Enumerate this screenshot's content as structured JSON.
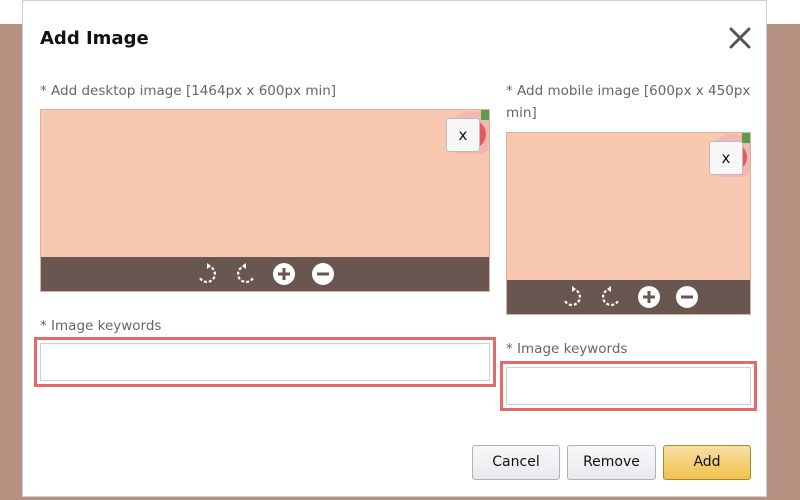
{
  "dialog": {
    "title": "Add Image"
  },
  "desktop": {
    "label": "* Add desktop image [1464px x 600px min]",
    "remove_label": "x",
    "keywords_label": "* Image keywords",
    "keywords_value": ""
  },
  "mobile": {
    "label_line1": "* Add mobile image [600px x 450px",
    "label_line2": "min]",
    "remove_label": "x",
    "keywords_label": "* Image keywords",
    "keywords_value": ""
  },
  "toolbar": {
    "icons": [
      "rotate-right-icon",
      "rotate-left-icon",
      "zoom-in-icon",
      "zoom-out-icon"
    ]
  },
  "buttons": {
    "cancel": "Cancel",
    "remove": "Remove",
    "add": "Add"
  },
  "colors": {
    "preview_bg": "#f8c9b0",
    "toolbar_bg": "#6a5650",
    "highlight": "#e16a6a",
    "add_button": "#f0c14b",
    "backdrop": "#b79283"
  }
}
